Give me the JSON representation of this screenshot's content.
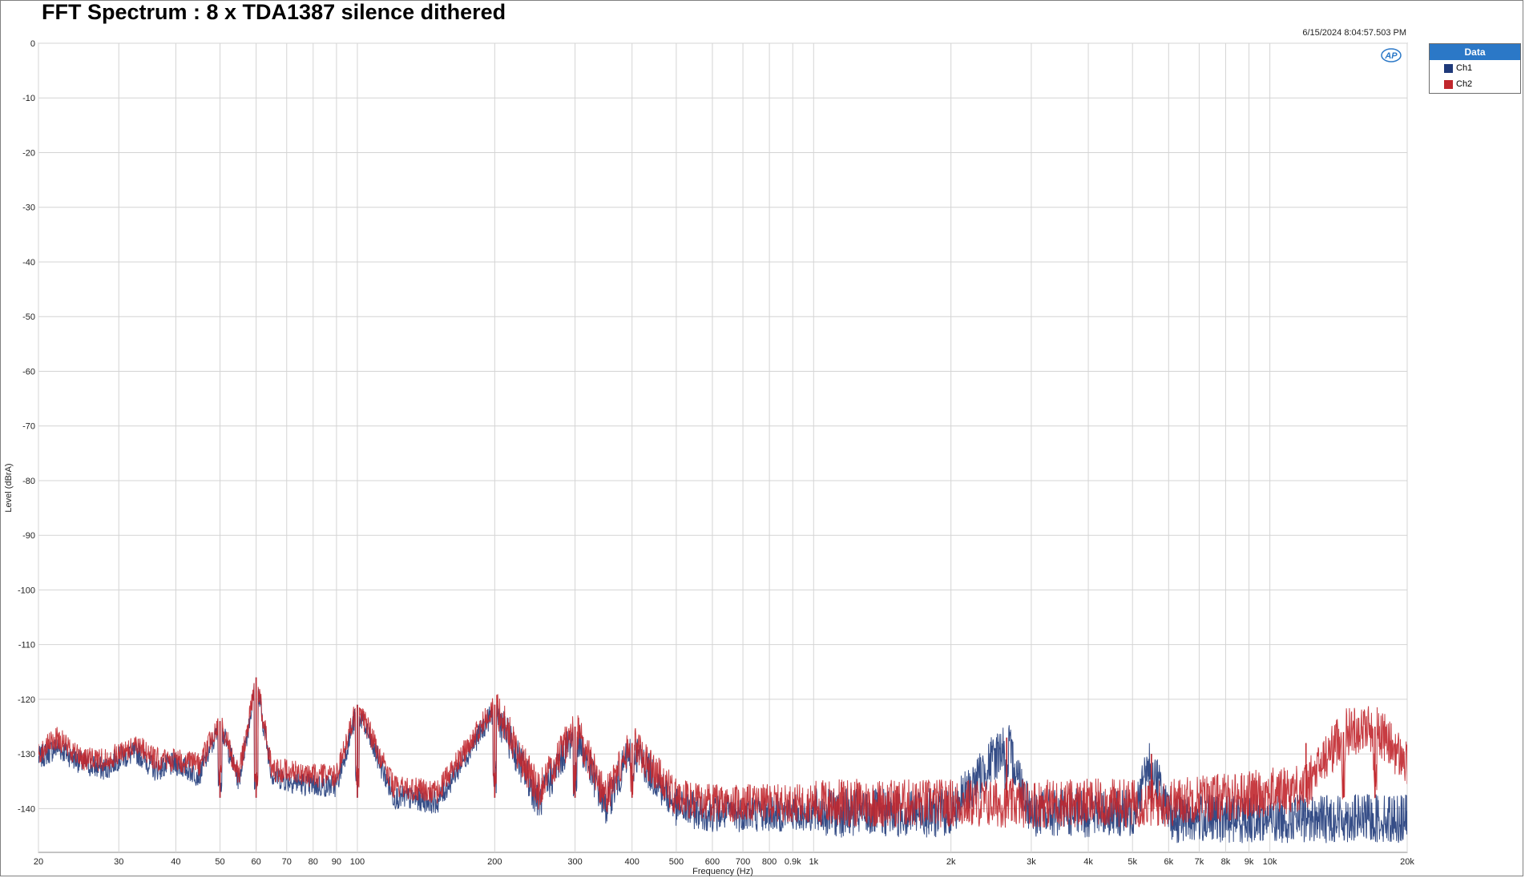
{
  "title": "FFT Spectrum : 8 x TDA1387 silence dithered",
  "timestamp": "6/15/2024 8:04:57.503 PM",
  "logo_text": "AP",
  "legend": {
    "header": "Data",
    "items": [
      {
        "label": "Ch1",
        "color": "#1f3a7a"
      },
      {
        "label": "Ch2",
        "color": "#c1272d"
      }
    ]
  },
  "chart_data": {
    "type": "line",
    "title": "FFT Spectrum : 8 x TDA1387 silence dithered",
    "xlabel": "Frequency (Hz)",
    "ylabel": "Level (dBrA)",
    "xscale": "log",
    "xlim": [
      20,
      20000
    ],
    "ylim": [
      -148,
      0
    ],
    "grid": true,
    "legend_position": "right",
    "x_ticks": [
      {
        "v": 20,
        "label": "20"
      },
      {
        "v": 30,
        "label": "30"
      },
      {
        "v": 40,
        "label": "40"
      },
      {
        "v": 50,
        "label": "50"
      },
      {
        "v": 60,
        "label": "60"
      },
      {
        "v": 70,
        "label": "70"
      },
      {
        "v": 80,
        "label": "80"
      },
      {
        "v": 90,
        "label": "90"
      },
      {
        "v": 100,
        "label": "100"
      },
      {
        "v": 200,
        "label": "200"
      },
      {
        "v": 300,
        "label": "300"
      },
      {
        "v": 400,
        "label": "400"
      },
      {
        "v": 500,
        "label": "500"
      },
      {
        "v": 600,
        "label": "600"
      },
      {
        "v": 700,
        "label": "700"
      },
      {
        "v": 800,
        "label": "800"
      },
      {
        "v": 900,
        "label": "0.9k"
      },
      {
        "v": 1000,
        "label": "1k"
      },
      {
        "v": 2000,
        "label": "2k"
      },
      {
        "v": 3000,
        "label": "3k"
      },
      {
        "v": 4000,
        "label": "4k"
      },
      {
        "v": 5000,
        "label": "5k"
      },
      {
        "v": 6000,
        "label": "6k"
      },
      {
        "v": 7000,
        "label": "7k"
      },
      {
        "v": 8000,
        "label": "8k"
      },
      {
        "v": 9000,
        "label": "9k"
      },
      {
        "v": 10000,
        "label": "10k"
      },
      {
        "v": 20000,
        "label": "20k"
      }
    ],
    "y_ticks": [
      0,
      -10,
      -20,
      -30,
      -40,
      -50,
      -60,
      -70,
      -80,
      -90,
      -100,
      -110,
      -120,
      -130,
      -140
    ],
    "series": [
      {
        "name": "Ch1",
        "color": "#1f3a7a",
        "x": [
          20,
          22,
          25,
          28,
          30,
          33,
          36,
          40,
          45,
          50,
          55,
          60,
          65,
          70,
          80,
          90,
          100,
          120,
          150,
          200,
          250,
          300,
          350,
          400,
          500,
          600,
          700,
          800,
          1000,
          1500,
          2000,
          2650,
          3000,
          4000,
          5000,
          5500,
          6000,
          7000,
          8000,
          10000,
          12000,
          15000,
          17500,
          20000
        ],
        "y": [
          -130,
          -128,
          -131,
          -132,
          -130,
          -129,
          -132,
          -131,
          -133,
          -124,
          -134,
          -116,
          -133,
          -134,
          -135,
          -135,
          -121,
          -137,
          -138,
          -121,
          -138,
          -125,
          -139,
          -128,
          -139,
          -140,
          -140,
          -140,
          -140,
          -140,
          -140,
          -127,
          -140,
          -140,
          -140,
          -130,
          -141,
          -141,
          -141,
          -141,
          -141,
          -141,
          -141,
          -141
        ]
      },
      {
        "name": "Ch2",
        "color": "#c1272d",
        "x": [
          20,
          22,
          25,
          28,
          30,
          33,
          36,
          40,
          45,
          50,
          55,
          60,
          65,
          70,
          80,
          90,
          100,
          120,
          150,
          200,
          250,
          300,
          350,
          400,
          500,
          600,
          700,
          800,
          1000,
          1500,
          2000,
          3000,
          4000,
          5000,
          6000,
          7000,
          8000,
          10000,
          12000,
          14500,
          17000,
          20000
        ],
        "y": [
          -130,
          -127,
          -131,
          -131,
          -130,
          -128,
          -131,
          -131,
          -132,
          -124,
          -134,
          -116,
          -133,
          -133,
          -134,
          -134,
          -121,
          -136,
          -137,
          -121,
          -137,
          -125,
          -138,
          -128,
          -138,
          -139,
          -139,
          -139,
          -139,
          -139,
          -139,
          -139,
          -139,
          -139,
          -139,
          -138,
          -138,
          -137,
          -136,
          -126,
          -125,
          -132
        ]
      }
    ],
    "peaks": [
      {
        "x": 50,
        "y": -124
      },
      {
        "x": 60,
        "y": -116
      },
      {
        "x": 100,
        "y": -121
      },
      {
        "x": 200,
        "y": -121
      },
      {
        "x": 300,
        "y": -125
      },
      {
        "x": 400,
        "y": -128
      },
      {
        "x": 2650,
        "y": -127
      },
      {
        "x": 5500,
        "y": -130
      },
      {
        "x": 12000,
        "y": -128
      },
      {
        "x": 14500,
        "y": -126
      },
      {
        "x": 17000,
        "y": -125
      }
    ]
  }
}
